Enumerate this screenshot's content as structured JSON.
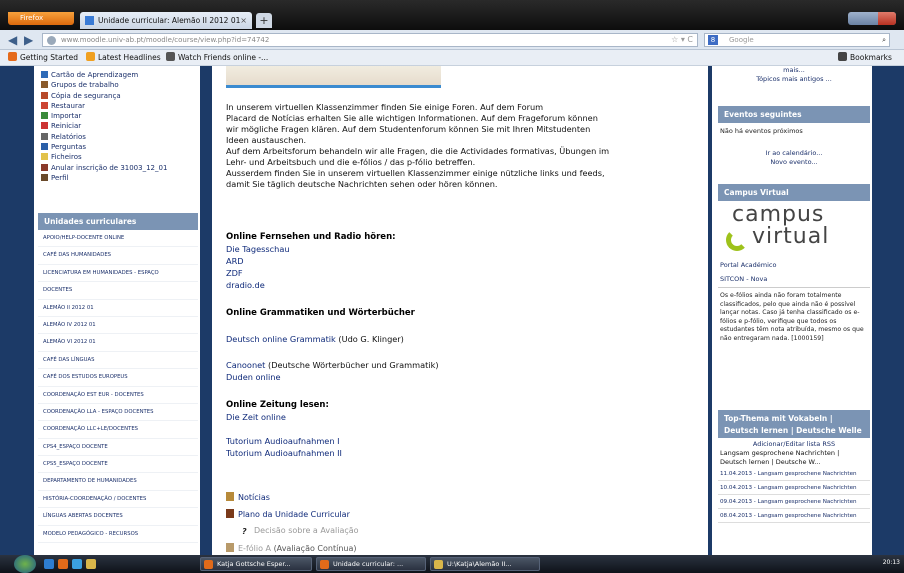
{
  "browser": {
    "app_button": "Firefox",
    "tab_title": "Unidade curricular: Alemão II 2012 01",
    "url": "www.moodle.univ-ab.pt/moodle/course/view.php?id=74742",
    "search_placeholder": "Google",
    "bookmarks": [
      "Getting Started",
      "Latest Headlines",
      "Watch Friends online -..."
    ],
    "bookmarks_right": "Bookmarks"
  },
  "admin_items": [
    "Cartão de Aprendizagem",
    "Grupos de trabalho",
    "Cópia de segurança",
    "Restaurar",
    "Importar",
    "Reiniciar",
    "Relatórios",
    "Perguntas",
    "Ficheiros",
    "Anular inscrição de 31003_12_01",
    "Perfil"
  ],
  "units": {
    "title": "Unidades curriculares",
    "items": [
      "APOIO/HELP-DOCENTE ONLINE",
      "CAFÉ DAS HUMANIDADES",
      "LICENCIATURA EM HUMANIDADES - ESPAÇO",
      "DOCENTES",
      "ALEMÃO II 2012 01",
      "ALEMÃO IV 2012 01",
      "ALEMÃO VI 2012 01",
      "CAFÉ DAS LÍNGUAS",
      "CAFÉ DOS ESTUDOS EUROPEUS",
      "COORDENAÇÃO EST EUR - DOCENTES",
      "COORDENAÇÃO LLA - ESPAÇO DOCENTES",
      "COORDENAÇÃO LLC+LE/DOCENTES",
      "CPS4_ESPAÇO DOCENTE",
      "CPS5_ESPAÇO DOCENTE",
      "DEPARTAMENTO DE HUMANIDADES",
      "HISTÓRIA-COORDENAÇÃO / DOCENTES",
      "LÍNGUAS ABERTAS DOCENTES",
      "MODELO PEDAGÓGICO - RECURSOS"
    ]
  },
  "main": {
    "intro": [
      "In unserem virtuellen Klassenzimmer finden Sie einige Foren. Auf dem Forum",
      "Placard de Notícias erhalten Sie alle wichtigen Informationen. Auf dem Frageforum können",
      "wir mögliche Fragen klären. Auf dem Studentenforum können Sie mit Ihren Mitstudenten",
      "Ideen austauschen.",
      "Auf dem Arbeitsforum behandeln wir alle Fragen, die die Actividades formativas, Übungen im",
      "Lehr- und Arbeitsbuch und die e-fólios / das p-fólio betreffen.",
      "Ausserdem finden Sie in unserem virtuellen Klassenzimmer einige nützliche links und feeds,",
      "damit Sie täglich deutsche Nachrichten sehen oder hören können."
    ],
    "tv_heading": "Online Fernsehen und Radio hören:",
    "tv_links": [
      "Die Tagesschau",
      "ARD",
      "ZDF",
      "dradio.de"
    ],
    "gram_heading": "Online Grammatiken und Wörterbücher",
    "gram_link1": "Deutsch online Grammatik",
    "gram_link1_note": "(Udo G. Klinger)",
    "gram_link2": "Canoonet",
    "gram_link2_note": "(Deutsche Wörterbücher und Grammatik)",
    "gram_link3": "Duden online",
    "zeit_heading": "Online Zeitung lesen:",
    "zeit_link": "Die Zeit online",
    "tutorials": [
      "Tutorium Audioaufnahmen I",
      "Tutorium Audioaufnahmen II"
    ],
    "modules": [
      "Notícias",
      "Plano da Unidade Curricular",
      "Decisão sobre a Avaliação",
      "E-fólio A"
    ],
    "efolio_note": "(Avaliação Contínua)"
  },
  "right": {
    "top_small": [
      "mais...",
      "Tópicos mais antigos ..."
    ],
    "events_title": "Eventos seguintes",
    "events_none": "Não há eventos próximos",
    "events_links": [
      "Ir ao calendário...",
      "Novo evento..."
    ],
    "cv_title": "Campus Virtual",
    "cv_logo_1": "campus",
    "cv_logo_2": "virtual",
    "cv_portal": "Portal Académico",
    "cv_sitcon": "SITCON - Nova",
    "cv_notice": "Os e-fólios ainda não foram totalmente classificados, pelo que ainda não é possível lançar notas. Caso já tenha classificado os e-fólios e p-fólio, verifique que todos os estudantes têm nota atribuída, mesmo os que não entregaram nada. [1000159]",
    "news_title": "Top-Thema mit Vokabeln | Deutsch lernen | Deutsche Welle",
    "news_admin": "Adicionar/Editar lista RSS",
    "news_feed": "Langsam gesprochene Nachrichten | Deutsch lernen | Deutsche W...",
    "news_items": [
      "11.04.2013 - Langsam gesprochene Nachrichten",
      "10.04.2013 - Langsam gesprochene Nachrichten",
      "09.04.2013 - Langsam gesprochene Nachrichten",
      "08.04.2013 - Langsam gesprochene Nachrichten"
    ]
  },
  "taskbar": {
    "tasks": [
      "Katja Gottsche Esper...",
      "Unidade curricular: ...",
      "U:\\Katja\\Alemão II..."
    ],
    "clock": "20:13"
  },
  "colors": {
    "block_header": "#7b94b4",
    "page_bg": "#1c3a67",
    "link": "#0f2a7a",
    "cv_green": "#9ec21b"
  }
}
